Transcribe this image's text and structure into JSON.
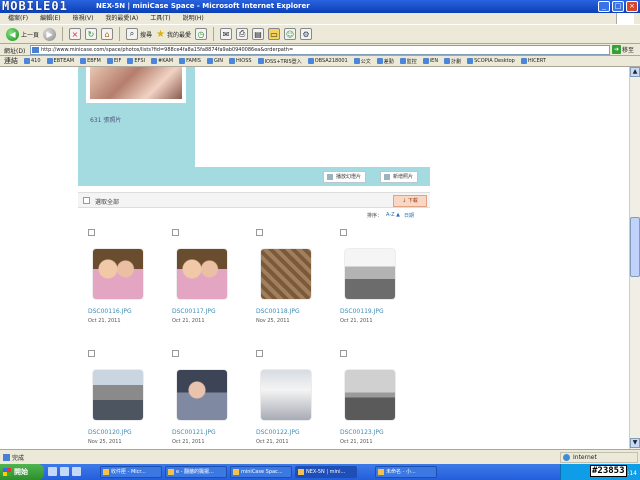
{
  "window": {
    "logo": "MOBILE01",
    "title": "NEX-5N | miniCase Space - Microsoft Internet Explorer"
  },
  "menu": [
    "檔案(F)",
    "編輯(E)",
    "檢視(V)",
    "我的最愛(A)",
    "工具(T)",
    "說明(H)"
  ],
  "toolbar": {
    "back_label": "上一頁",
    "search_label": "搜尋",
    "favorites_label": "我的最愛"
  },
  "address": {
    "label": "網址(D)",
    "url": "http://www.minicase.com/space/photos/lists?fid=988ce4fa8a15fa8874fa9ab0940086ea&orderpath=",
    "go_label": "移至"
  },
  "links": {
    "label": "連結",
    "items": [
      "410",
      "EBTEAM",
      "EBFM",
      "EIF",
      "EFSI",
      "#KAM",
      "FAMIS",
      "GIN",
      "HIOSS",
      "IOSS+TRIS登入",
      "OBSA218001",
      "公文",
      "差勤",
      "監控",
      "iEN",
      "計劃",
      "SCOPIA Desktop",
      "HICERT"
    ]
  },
  "album": {
    "count_text": "631 張照片",
    "slideshow_label": "播放幻燈片",
    "add_label": "新增照片"
  },
  "selectbar": {
    "select_all": "選取全部",
    "download": "下載"
  },
  "sort": {
    "label": "排序：",
    "az": "A-Z ▲",
    "date": "日期"
  },
  "photos": [
    {
      "name": "DSC00116.JPG",
      "date": "Oct 21, 2011",
      "kind": "couple"
    },
    {
      "name": "DSC00117.JPG",
      "date": "Oct 21, 2011",
      "kind": "couple"
    },
    {
      "name": "DSC00118.JPG",
      "date": "Nov 25, 2011",
      "kind": "bag"
    },
    {
      "name": "DSC00119.JPG",
      "date": "Oct 21, 2011",
      "kind": "station"
    },
    {
      "name": "DSC00120.JPG",
      "date": "Nov 25, 2011",
      "kind": "street"
    },
    {
      "name": "DSC00121.JPG",
      "date": "Oct 21, 2011",
      "kind": "office"
    },
    {
      "name": "DSC00122.JPG",
      "date": "Oct 21, 2011",
      "kind": "ticket"
    },
    {
      "name": "DSC00123.JPG",
      "date": "Oct 21, 2011",
      "kind": "plane"
    }
  ],
  "status": {
    "done": "完成",
    "zone": "Internet"
  },
  "taskbar": {
    "start": "開始",
    "tasks": [
      "收件匣 - Micr...",
      "e - 翻牆的飄揚...",
      "miniCase Spac...",
      "NEX-5N | mini...",
      "未命名 - 小..."
    ],
    "clock": "下午 02:14"
  },
  "watermark": "#23853"
}
